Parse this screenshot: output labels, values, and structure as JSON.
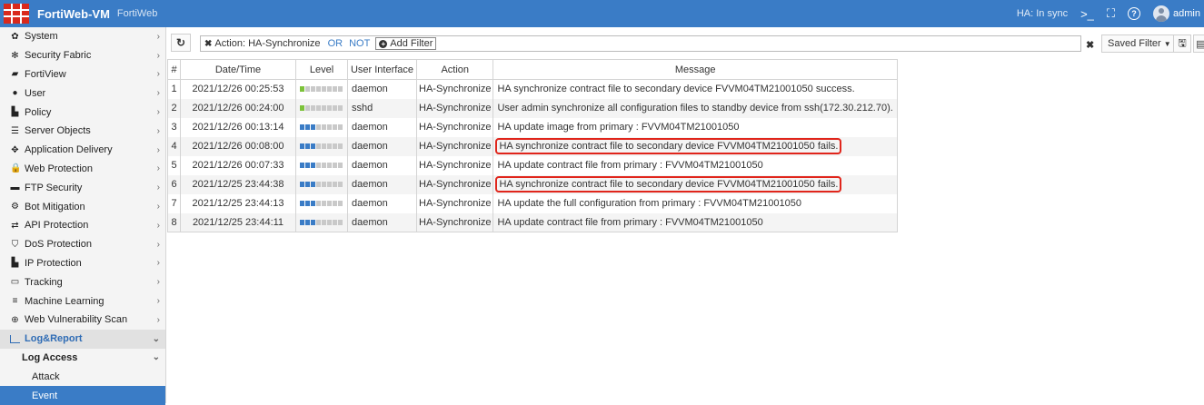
{
  "app": {
    "title": "FortiWeb-VM",
    "subtitle": "FortiWeb"
  },
  "topbar": {
    "ha_status": "HA: In sync",
    "cli_icon": ">_",
    "fullscreen_icon": "⛶",
    "help_icon": "?",
    "user": "admin"
  },
  "sidebar": {
    "items": [
      {
        "label": "System",
        "icon": "gear-icon"
      },
      {
        "label": "Security Fabric",
        "icon": "fabric-icon"
      },
      {
        "label": "FortiView",
        "icon": "chart-icon"
      },
      {
        "label": "User",
        "icon": "user-icon"
      },
      {
        "label": "Policy",
        "icon": "policy-icon"
      },
      {
        "label": "Server Objects",
        "icon": "server-icon"
      },
      {
        "label": "Application Delivery",
        "icon": "delivery-icon"
      },
      {
        "label": "Web Protection",
        "icon": "lock-icon"
      },
      {
        "label": "FTP Security",
        "icon": "folder-icon"
      },
      {
        "label": "Bot Mitigation",
        "icon": "bot-icon"
      },
      {
        "label": "API Protection",
        "icon": "api-icon"
      },
      {
        "label": "DoS Protection",
        "icon": "shield-icon"
      },
      {
        "label": "IP Protection",
        "icon": "ip-icon"
      },
      {
        "label": "Tracking",
        "icon": "tracking-icon"
      },
      {
        "label": "Machine Learning",
        "icon": "menu-icon"
      },
      {
        "label": "Web Vulnerability Scan",
        "icon": "scan-icon"
      }
    ],
    "active_section": "Log&Report",
    "sub_section": "Log Access",
    "sub_items": [
      "Attack",
      "Event"
    ]
  },
  "toolbar": {
    "filter_label": "Action: HA-Synchronize",
    "filter_or": "OR",
    "filter_not": "NOT",
    "add_filter": "Add Filter",
    "saved_filter": "Saved Filter"
  },
  "table": {
    "headers": {
      "num": "#",
      "date": "Date/Time",
      "level": "Level",
      "ui": "User Interface",
      "action": "Action",
      "message": "Message"
    },
    "rows": [
      {
        "num": "1",
        "date": "2021/12/26 00:25:53",
        "level": "information",
        "ui": "daemon",
        "action": "HA-Synchronize",
        "message": "HA synchronize contract file to secondary device FVVM04TM21001050 success."
      },
      {
        "num": "2",
        "date": "2021/12/26 00:24:00",
        "level": "information",
        "ui": "sshd",
        "action": "HA-Synchronize",
        "message": "User admin synchronize all configuration files to standby device from ssh(172.30.212.70)."
      },
      {
        "num": "3",
        "date": "2021/12/26 00:13:14",
        "level": "warning",
        "ui": "daemon",
        "action": "HA-Synchronize",
        "message": "HA update image from primary : FVVM04TM21001050"
      },
      {
        "num": "4",
        "date": "2021/12/26 00:08:00",
        "level": "warning",
        "ui": "daemon",
        "action": "HA-Synchronize",
        "message": "HA synchronize contract file to secondary device FVVM04TM21001050 fails."
      },
      {
        "num": "5",
        "date": "2021/12/26 00:07:33",
        "level": "warning",
        "ui": "daemon",
        "action": "HA-Synchronize",
        "message": "HA update contract file from primary : FVVM04TM21001050"
      },
      {
        "num": "6",
        "date": "2021/12/25 23:44:38",
        "level": "warning",
        "ui": "daemon",
        "action": "HA-Synchronize",
        "message": "HA synchronize contract file to secondary device FVVM04TM21001050 fails."
      },
      {
        "num": "7",
        "date": "2021/12/25 23:44:13",
        "level": "warning",
        "ui": "daemon",
        "action": "HA-Synchronize",
        "message": "HA update the full configuration from primary : FVVM04TM21001050"
      },
      {
        "num": "8",
        "date": "2021/12/25 23:44:11",
        "level": "warning",
        "ui": "daemon",
        "action": "HA-Synchronize",
        "message": "HA update contract file from primary : FVVM04TM21001050"
      }
    ]
  },
  "colors": {
    "accent": "#3a7cc6",
    "highlight": "#e0251b",
    "info_level": "#7cc23a"
  }
}
